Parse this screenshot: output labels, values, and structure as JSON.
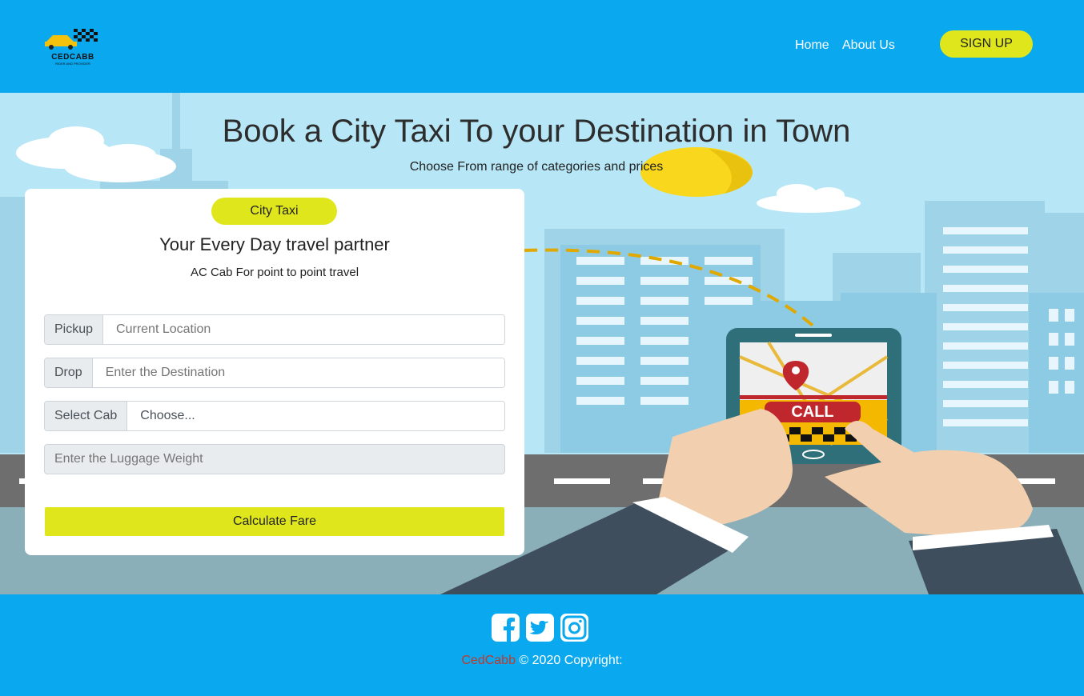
{
  "header": {
    "logo_text": "CEDCABB",
    "logo_sub": "RIDER AND PROVIDER",
    "nav": [
      "Home",
      "About Us"
    ],
    "signup_label": "SIGN UP"
  },
  "hero": {
    "title": "Book a City Taxi To your Destination in Town",
    "subtitle": "Choose From range of categories and prices",
    "phone_label": "CALL"
  },
  "booking": {
    "badge": "City Taxi",
    "title": "Your Every Day travel partner",
    "subtitle": "AC Cab For point to point travel",
    "pickup": {
      "label": "Pickup",
      "placeholder": "Current Location"
    },
    "drop": {
      "label": "Drop",
      "placeholder": "Enter the Destination"
    },
    "cab": {
      "label": "Select Cab",
      "selected": "Choose..."
    },
    "luggage_placeholder": "Enter the Luggage Weight",
    "calculate_label": "Calculate Fare"
  },
  "footer": {
    "social_icons": [
      "facebook-icon",
      "twitter-icon",
      "instagram-icon"
    ],
    "brand": "CedCabb",
    "copyright": "© 2020 Copyright:"
  },
  "colors": {
    "primary": "#0aa8ef",
    "accent": "#dfe71c",
    "brand_red": "#c0392b"
  }
}
